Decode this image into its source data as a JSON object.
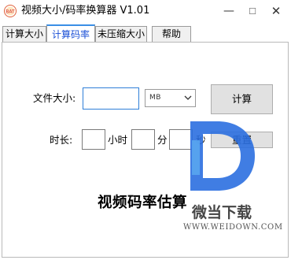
{
  "window": {
    "title": "视频大小/码率换算器 V1.01",
    "minimize_glyph": "—",
    "maximize_glyph": "☐",
    "close_glyph": "✕"
  },
  "tabs": [
    {
      "label": "计算大小",
      "active": false
    },
    {
      "label": "计算码率",
      "active": true
    },
    {
      "label": "未压缩大小",
      "active": false
    },
    {
      "label": "帮助",
      "active": false
    }
  ],
  "form": {
    "file_size_label": "文件大小:",
    "file_size_value": "",
    "unit_selected": "MB",
    "calc_button": "计算",
    "duration_label": "时长:",
    "hours_value": "",
    "hours_unit": "小时",
    "minutes_value": "",
    "minutes_unit": "分",
    "seconds_value": "",
    "seconds_unit": "秒",
    "reset_button": "重置"
  },
  "result_title": "视频码率估算",
  "watermark": {
    "brand": "微当下载",
    "url": "WWW.WEIDOWN.COM",
    "colors": {
      "primary": "#2b6fe0",
      "secondary": "#5aa8f0"
    }
  }
}
